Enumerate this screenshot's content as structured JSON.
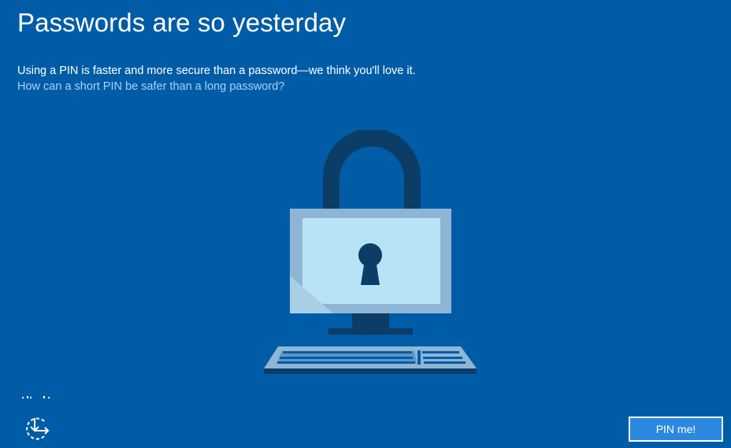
{
  "page": {
    "title": "Passwords are so yesterday",
    "subtitle": "Using a PIN is faster and more secure than a password—we think you'll love it.",
    "help_link": "How can a short PIN be safer than a long password?"
  },
  "footer": {
    "accessibility_icon": "accessibility-icon",
    "pin_button_label": "PIN me!"
  },
  "illustration": {
    "icon": "lock-computer-illustration"
  },
  "colors": {
    "background": "#005ca6",
    "link": "#a8d3f5",
    "button": "#2a88de",
    "lock_dark": "#0b3d66",
    "screen_frame": "#8fb5d4",
    "screen": "#b7e3f5"
  }
}
